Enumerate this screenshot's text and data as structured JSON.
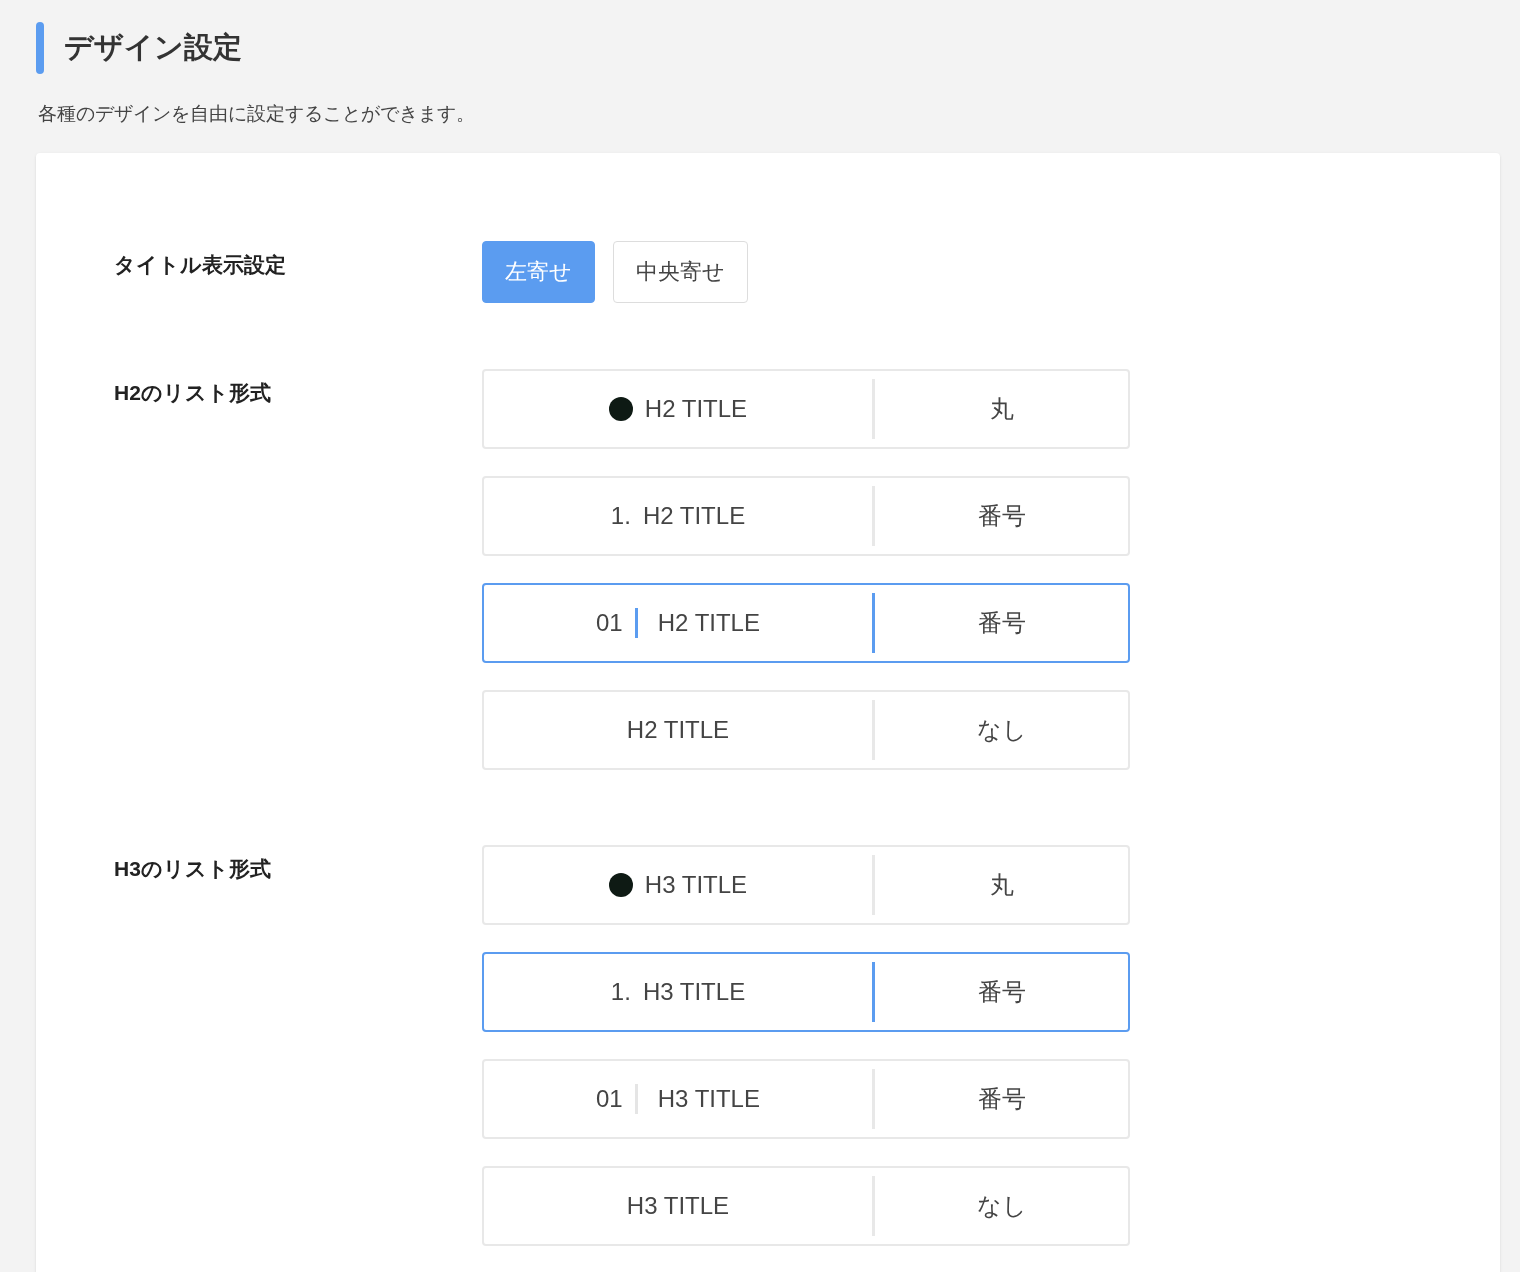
{
  "header": {
    "title": "デザイン設定",
    "description": "各種のデザインを自由に設定することができます。"
  },
  "settings": [
    {
      "label": "タイトル表示設定",
      "kind": "buttons",
      "buttons": [
        {
          "label": "左寄せ",
          "selected": true
        },
        {
          "label": "中央寄せ",
          "selected": false
        }
      ]
    },
    {
      "label": "H2のリスト形式",
      "kind": "list",
      "options": [
        {
          "kind": "dot",
          "title": "H2 TITLE",
          "name": "丸",
          "selected": false
        },
        {
          "kind": "number",
          "prefix": "1.",
          "title": "H2 TITLE",
          "name": "番号",
          "selected": false
        },
        {
          "kind": "bar",
          "prefix": "01",
          "title": "H2 TITLE",
          "name": "番号",
          "selected": true
        },
        {
          "kind": "plain",
          "title": "H2 TITLE",
          "name": "なし",
          "selected": false
        }
      ]
    },
    {
      "label": "H3のリスト形式",
      "kind": "list",
      "options": [
        {
          "kind": "dot",
          "title": "H3 TITLE",
          "name": "丸",
          "selected": false
        },
        {
          "kind": "number",
          "prefix": "1.",
          "title": "H3 TITLE",
          "name": "番号",
          "selected": true
        },
        {
          "kind": "bar",
          "prefix": "01",
          "title": "H3 TITLE",
          "name": "番号",
          "selected": false
        },
        {
          "kind": "plain",
          "title": "H3 TITLE",
          "name": "なし",
          "selected": false
        }
      ]
    }
  ]
}
